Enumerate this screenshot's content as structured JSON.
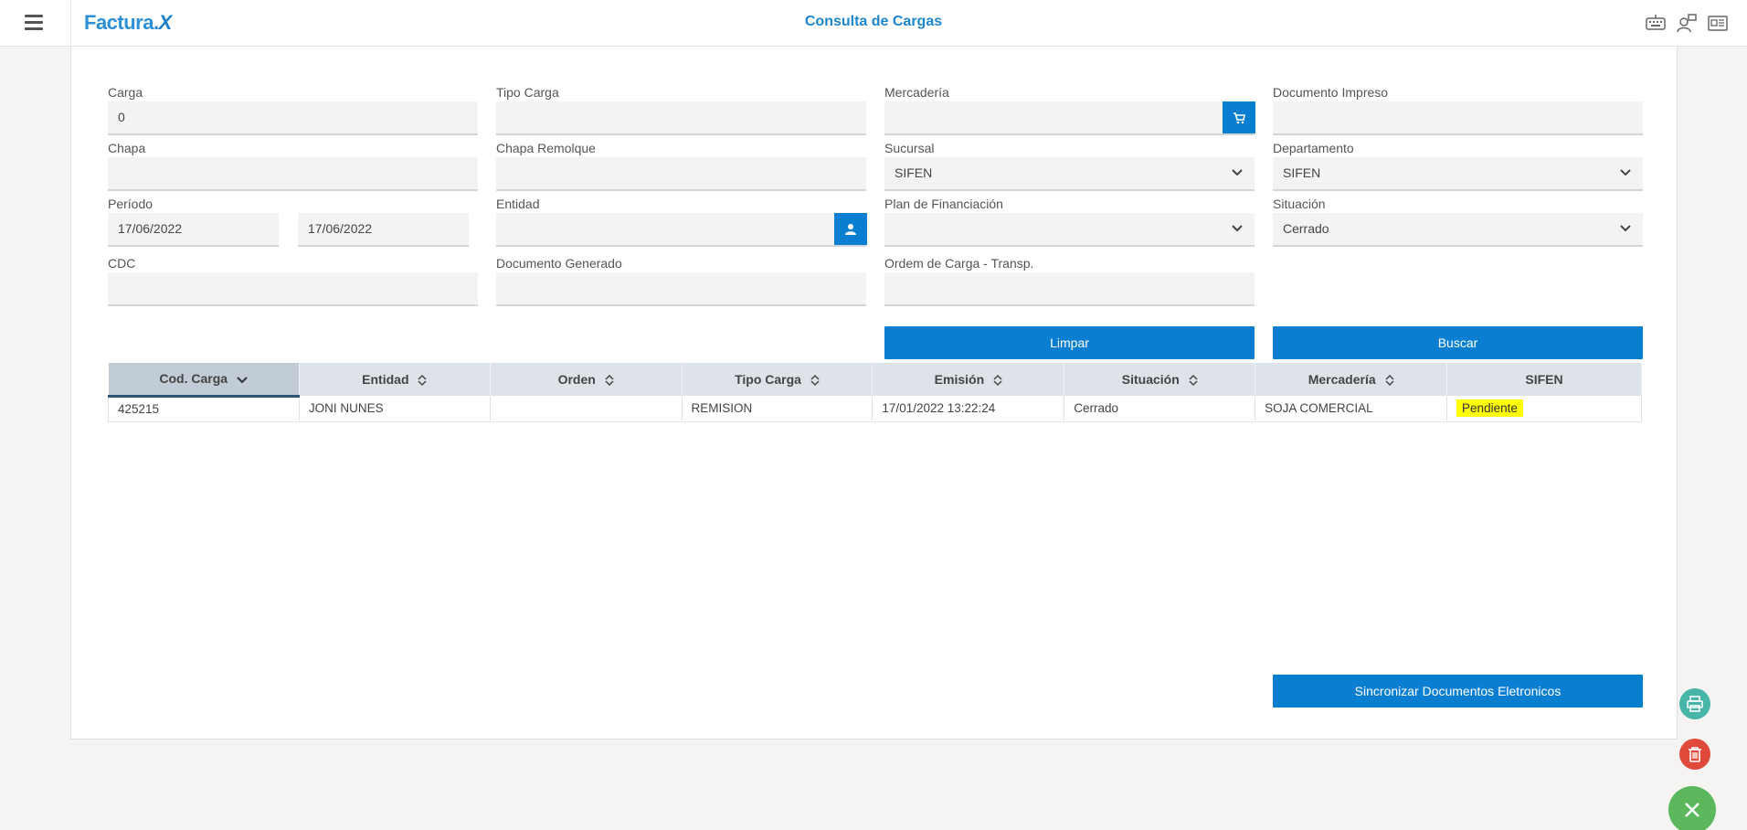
{
  "header": {
    "logo_main": "Factura",
    "logo_x": "X",
    "title": "Consulta de Cargas",
    "icons": [
      "keyboard-icon",
      "user-switch-icon",
      "id-card-icon"
    ]
  },
  "form": {
    "carga": {
      "label": "Carga",
      "value": "0"
    },
    "tipo_carga": {
      "label": "Tipo Carga",
      "value": ""
    },
    "mercaderia": {
      "label": "Mercadería",
      "value": ""
    },
    "documento_impreso": {
      "label": "Documento Impreso",
      "value": ""
    },
    "chapa": {
      "label": "Chapa",
      "value": ""
    },
    "chapa_remolque": {
      "label": "Chapa Remolque",
      "value": ""
    },
    "sucursal": {
      "label": "Sucursal",
      "value": "SIFEN"
    },
    "departamento": {
      "label": "Departamento",
      "value": "SIFEN"
    },
    "periodo": {
      "label": "Período",
      "from": "17/06/2022",
      "to": "17/06/2022"
    },
    "entidad": {
      "label": "Entidad",
      "value": ""
    },
    "plan_financiacion": {
      "label": "Plan de Financiación",
      "value": ""
    },
    "situacion": {
      "label": "Situación",
      "value": "Cerrado"
    },
    "cdc": {
      "label": "CDC",
      "value": ""
    },
    "documento_generado": {
      "label": "Documento Generado",
      "value": ""
    },
    "orden_carga": {
      "label": "Ordem de Carga - Transp.",
      "value": ""
    }
  },
  "buttons": {
    "limpar": "Limpar",
    "buscar": "Buscar",
    "sincronizar": "Sincronizar Documentos Eletronicos"
  },
  "table": {
    "columns": [
      "Cod. Carga",
      "Entidad",
      "Orden",
      "Tipo Carga",
      "Emisión",
      "Situación",
      "Mercadería",
      "SIFEN"
    ],
    "rows": [
      {
        "cod_carga": "425215",
        "entidad": "JONI NUNES",
        "orden": "",
        "tipo_carga": "REMISION",
        "emision": "17/01/2022 13:22:24",
        "situacion": "Cerrado",
        "mercaderia": "SOJA COMERCIAL",
        "sifen": "Pendiente"
      }
    ]
  },
  "colors": {
    "primary": "#0a7fd2",
    "highlight": "#ffff00",
    "print_fab": "#47b6a8",
    "delete_fab": "#e04a3b",
    "close_fab": "#5cb85c"
  }
}
